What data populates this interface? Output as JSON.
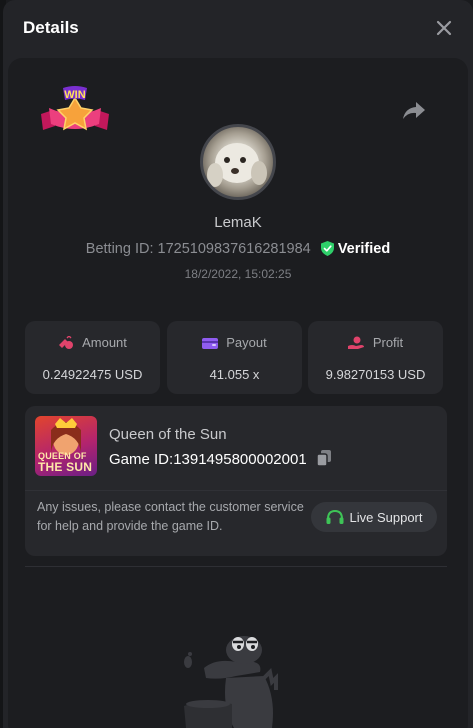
{
  "header": {
    "title": "Details"
  },
  "bet": {
    "win_badge": "WIN",
    "username": "LemaK",
    "betting_label": "Betting ID:",
    "betting_id": "1725109837616281984",
    "verified_label": "Verified",
    "timestamp": "18/2/2022, 15:02:25"
  },
  "stats": [
    {
      "label": "Amount",
      "value": "0.24922475 USD",
      "icon": "coins-icon",
      "color": "#e0436b"
    },
    {
      "label": "Payout",
      "value": "41.055 x",
      "icon": "wallet-icon",
      "color": "#8f5cf0"
    },
    {
      "label": "Profit",
      "value": "9.98270153 USD",
      "icon": "hand-coin-icon",
      "color": "#e0436b"
    }
  ],
  "game": {
    "name": "Queen of the Sun",
    "id_label": "Game ID:",
    "id_value": "1391495800002001",
    "thumb_line1": "QUEEN OF",
    "thumb_line2": "THE SUN"
  },
  "support": {
    "message": "Any issues, please contact the customer service for help and provide the game ID.",
    "button_label": "Live Support"
  },
  "colors": {
    "verified_green": "#2fcf6a",
    "accent_pink": "#e0436b",
    "accent_purple": "#8f5cf0",
    "support_green": "#3ec457"
  }
}
